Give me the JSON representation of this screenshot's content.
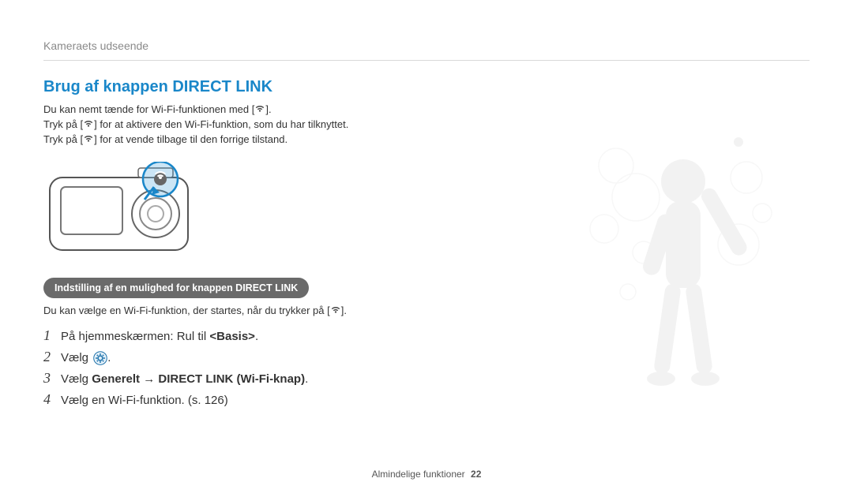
{
  "breadcrumb": "Kameraets udseende",
  "title": "Brug af knappen DIRECT LINK",
  "intro": {
    "line1_pre": "Du kan nemt tænde for Wi-Fi-funktionen med [",
    "line1_post": "].",
    "line2_pre": "Tryk på [",
    "line2_post": "] for at aktivere den Wi-Fi-funktion, som du har tilknyttet.",
    "line3_pre": "Tryk på [",
    "line3_post": "] for at vende tilbage til den forrige tilstand."
  },
  "subheading": "Indstilling af en mulighed for knappen DIRECT LINK",
  "subtext_pre": "Du kan vælge en Wi-Fi-funktion, der startes, når du trykker på [",
  "subtext_post": "].",
  "steps": [
    {
      "n": "1",
      "html": "På hjemmeskærmen: Rul til <b>&lt;Basis&gt;</b>."
    },
    {
      "n": "2",
      "html": "Vælg {gear}."
    },
    {
      "n": "3",
      "html": "Vælg <b>Generelt</b> → <b>DIRECT LINK (Wi-Fi-knap)</b>."
    },
    {
      "n": "4",
      "html": "Vælg en Wi-Fi-funktion. (s. 126)"
    }
  ],
  "footer": {
    "section": "Almindelige funktioner",
    "page": "22"
  },
  "icons": {
    "wifi": "wifi-icon",
    "gear": "gear-icon"
  }
}
